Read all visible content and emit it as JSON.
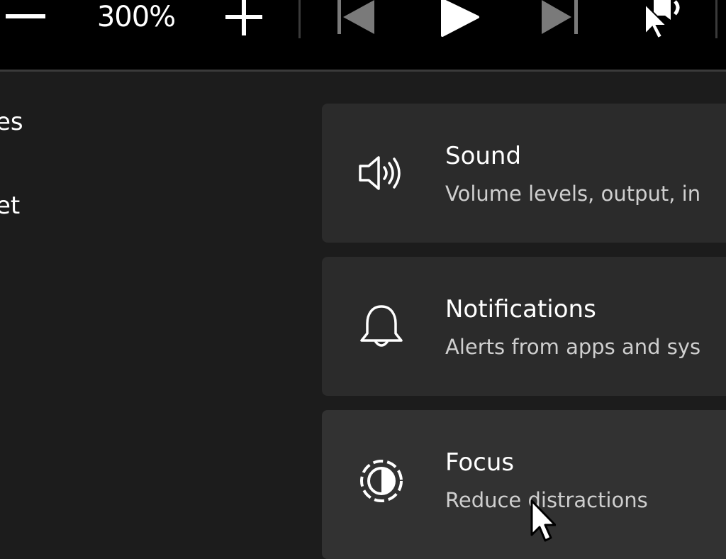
{
  "toolbar": {
    "zoom_level": "300%",
    "icons": [
      "zoom-out-icon",
      "zoom-in-icon",
      "previous-icon",
      "play-icon",
      "next-icon",
      "speaker-icon"
    ]
  },
  "sidebar": {
    "items": [
      {
        "label": "es"
      },
      {
        "label": "et"
      }
    ]
  },
  "cards": [
    {
      "title": "Sound",
      "subtitle": "Volume levels, output, in",
      "icon": "speaker-icon"
    },
    {
      "title": "Notifications",
      "subtitle": "Alerts from apps and sys",
      "icon": "bell-icon"
    },
    {
      "title": "Focus",
      "subtitle": "Reduce distractions",
      "icon": "focus-icon"
    }
  ],
  "colors": {
    "toolbar_bg": "#000000",
    "page_bg": "#1c1c1c",
    "card_bg": "#2b2b2b",
    "card_hover_bg": "#323232"
  }
}
